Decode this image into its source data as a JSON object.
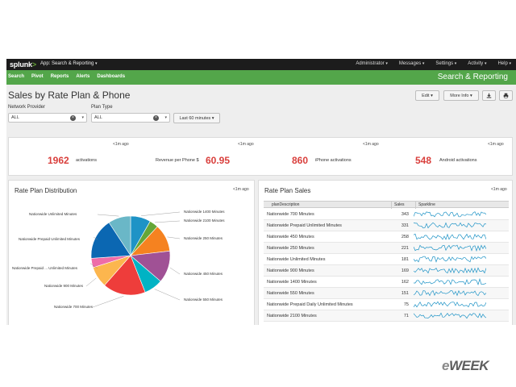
{
  "topbar": {
    "logo": "splunk",
    "logo_suffix": ">",
    "app_menu": "App: Search & Reporting",
    "right_menu": [
      {
        "label": "Administrator"
      },
      {
        "label": "Messages"
      },
      {
        "label": "Settings"
      },
      {
        "label": "Activity"
      },
      {
        "label": "Help"
      }
    ]
  },
  "nav": {
    "items": [
      {
        "label": "Search"
      },
      {
        "label": "Pivot"
      },
      {
        "label": "Reports"
      },
      {
        "label": "Alerts"
      },
      {
        "label": "Dashboards"
      }
    ],
    "app_title": "Search & Reporting"
  },
  "page": {
    "title": "Sales by Rate Plan & Phone",
    "edit_label": "Edit",
    "more_info_label": "More Info"
  },
  "inputs": {
    "network_label": "Network Provider",
    "network_value": "ALL",
    "plan_label": "Plan Type",
    "plan_value": "ALL",
    "time_label": "Last 60 minutes"
  },
  "singles": {
    "ago": "<1m ago",
    "items": [
      {
        "value": "1962",
        "label": "activations",
        "pre_label": ""
      },
      {
        "value": "60.95",
        "label": "",
        "pre_label": "Revenue per Phone $"
      },
      {
        "value": "860",
        "label": "iPhone activations",
        "pre_label": ""
      },
      {
        "value": "548",
        "label": "Android activations",
        "pre_label": ""
      }
    ],
    "value_color": "#d93f3c"
  },
  "pie_panel": {
    "title": "Rate Plan Distribution",
    "ago": "<1m ago"
  },
  "table_panel": {
    "title": "Rate Plan Sales",
    "ago": "<1m ago",
    "columns": [
      "planDescription",
      "Sales",
      "Sparkline"
    ]
  },
  "chart_data": {
    "type": "pie",
    "title": "Rate Plan Distribution",
    "categories": [
      "Nationwide 1400 Minutes",
      "Nationwide 2100 Minutes",
      "Nationwide 250 Minutes",
      "Nationwide 450 Minutes",
      "Nationwide 550 Minutes",
      "Nationwide 700 Minutes",
      "Nationwide 900 Minutes",
      "Nationwide Prepaid ... Unlimited Minutes",
      "Nationwide Prepaid Unlimited Minutes",
      "Nationwide Unlimited Minutes"
    ],
    "values": [
      162,
      71,
      221,
      258,
      151,
      343,
      169,
      75,
      331,
      181
    ],
    "colors": [
      "#1e93c6",
      "#65a637",
      "#f58220",
      "#a05195",
      "#00b3c4",
      "#ee3d3b",
      "#fcb64e",
      "#ee6ca8",
      "#0b67b2",
      "#6ab7c7"
    ],
    "legend": "labels"
  },
  "table_rows": [
    {
      "desc": "Nationwide 700 Minutes",
      "sales": "343"
    },
    {
      "desc": "Nationwide Prepaid Unlimited Minutes",
      "sales": "331"
    },
    {
      "desc": "Nationwide 450 Minutes",
      "sales": "258"
    },
    {
      "desc": "Nationwide 250 Minutes",
      "sales": "221"
    },
    {
      "desc": "Nationwide Unlimited Minutes",
      "sales": "181"
    },
    {
      "desc": "Nationwide 900 Minutes",
      "sales": "169"
    },
    {
      "desc": "Nationwide 1400 Minutes",
      "sales": "162"
    },
    {
      "desc": "Nationwide 550 Minutes",
      "sales": "151"
    },
    {
      "desc": "Nationwide Prepaid Daily Unlimited Minutes",
      "sales": "75"
    },
    {
      "desc": "Nationwide 2100 Minutes",
      "sales": "71"
    }
  ],
  "watermark": {
    "prefix": "e",
    "text": "WEEK"
  },
  "colors": {
    "green_bar": "#53a64a",
    "top_bar": "#1c1c1c",
    "sparkline": "#1e93c6"
  },
  "icons": [
    "clear-icon",
    "chevron-down-icon",
    "download-icon",
    "print-icon"
  ]
}
